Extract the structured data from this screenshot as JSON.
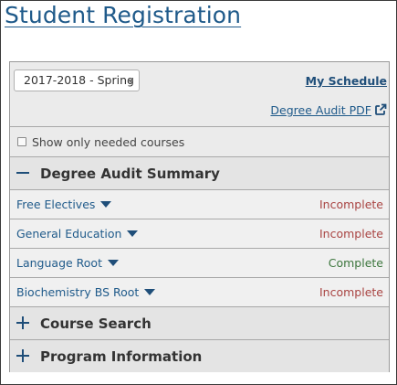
{
  "page": {
    "title": "Student Registration"
  },
  "controls": {
    "term_select": {
      "selected": "2017-2018 - Spring"
    },
    "my_schedule_label": "My Schedule",
    "degree_audit_pdf_label": "Degree Audit PDF",
    "show_needed_label": "Show only needed courses",
    "show_needed_checked": false
  },
  "sections": {
    "degree_audit": {
      "label": "Degree Audit Summary",
      "expanded": true,
      "items": [
        {
          "name": "Free Electives",
          "status": "Incomplete",
          "state": "incomplete"
        },
        {
          "name": "General Education",
          "status": "Incomplete",
          "state": "incomplete"
        },
        {
          "name": "Language Root",
          "status": "Complete",
          "state": "complete"
        },
        {
          "name": "Biochemistry BS Root",
          "status": "Incomplete",
          "state": "incomplete"
        }
      ]
    },
    "course_search": {
      "label": "Course Search",
      "expanded": false
    },
    "program_information": {
      "label": "Program Information",
      "expanded": false
    }
  },
  "colors": {
    "link": "#1f5a8a",
    "incomplete": "#a94442",
    "complete": "#3c763d"
  },
  "icons": {
    "external_link": "external-link-icon",
    "collapse": "minus-icon",
    "expand": "plus-icon",
    "dropdown": "caret-down-icon"
  }
}
